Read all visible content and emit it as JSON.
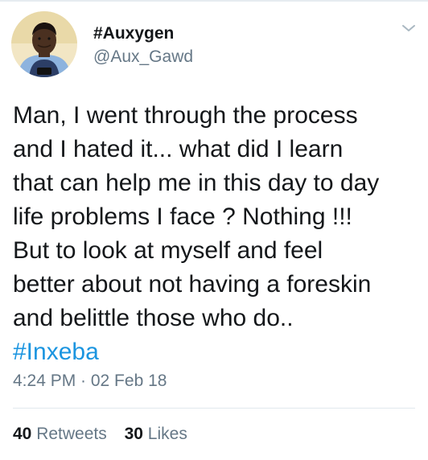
{
  "tweet": {
    "author": {
      "display_name": "#Auxygen",
      "handle": "@Aux_Gawd",
      "avatar_icon": "profile-photo"
    },
    "menu_icon": "chevron-down-icon",
    "body_lines": [
      "Man, I went through the process",
      "and I hated it... what did I learn",
      "that can help me in this day to day",
      "life problems I face ? Nothing !!!",
      "But to look at myself and feel",
      "better about not having a foreskin",
      "and belittle those who do.."
    ],
    "hashtag": "#Inxeba",
    "timestamp": "4:24 PM · 02 Feb 18",
    "stats": {
      "retweets_count": "40",
      "retweets_label": "Retweets",
      "likes_count": "30",
      "likes_label": "Likes"
    }
  },
  "colors": {
    "link": "#1b95e0",
    "secondary_text": "#657786",
    "primary_text": "#14171a",
    "divider": "#e1e8ed"
  }
}
